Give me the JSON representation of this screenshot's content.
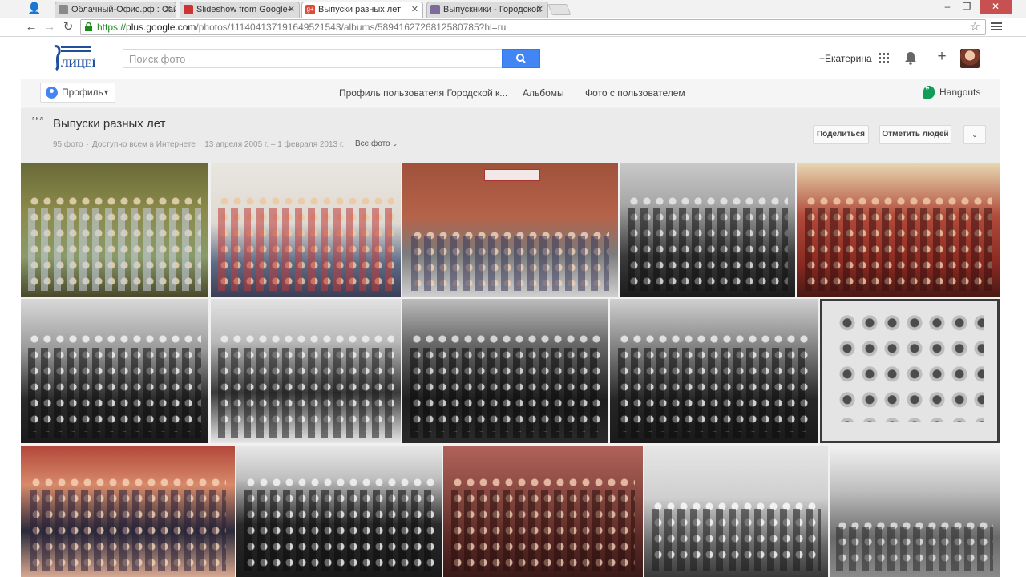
{
  "browser": {
    "tabs": [
      {
        "title": "Облачный-Офис.рф : Сайт",
        "favicon_color": "#777777",
        "active": false
      },
      {
        "title": "Slideshow from Google+",
        "favicon_color": "#cc3333",
        "active": false
      },
      {
        "title": "Выпуски разных лет",
        "favicon_color": "#dd4b39",
        "active": true
      },
      {
        "title": "Выпускники - Городской",
        "favicon_color": "#7d6b9c",
        "active": false
      }
    ],
    "tab_close": "✕",
    "url_https": "https://",
    "url_host": "plus.google.com",
    "url_path": "/photos/111404137191649521543/albums/5894162726812580785?hl=ru",
    "buttons": {
      "back": "←",
      "forward": "→",
      "reload": "↻",
      "star": "☆",
      "minimize": "–",
      "restore": "❐",
      "close": "✕"
    }
  },
  "gplus": {
    "logo_text": "ЛИЦЕЙ",
    "search_placeholder": "Поиск фото",
    "user_name": "+Екатерина",
    "plus_label": "+",
    "profile_button": "Профиль",
    "nav_links": [
      "Профиль пользователя Городской к...",
      "Альбомы",
      "Фото с пользователем"
    ],
    "hangouts": "Hangouts",
    "album": {
      "logo_text": "г к л",
      "title": "Выпуски разных лет",
      "meta": [
        "95 фото",
        "Доступно всем в Интернете",
        "13 апреля 2005 г. – 1 февраля 2013 г."
      ],
      "meta_separator": "·",
      "all_photos": "Все фото",
      "share_button": "Поделиться",
      "tag_button": "Отметить людей"
    },
    "colors": {
      "accent": "#4285f4",
      "hangouts_green": "#0f9d58"
    }
  }
}
